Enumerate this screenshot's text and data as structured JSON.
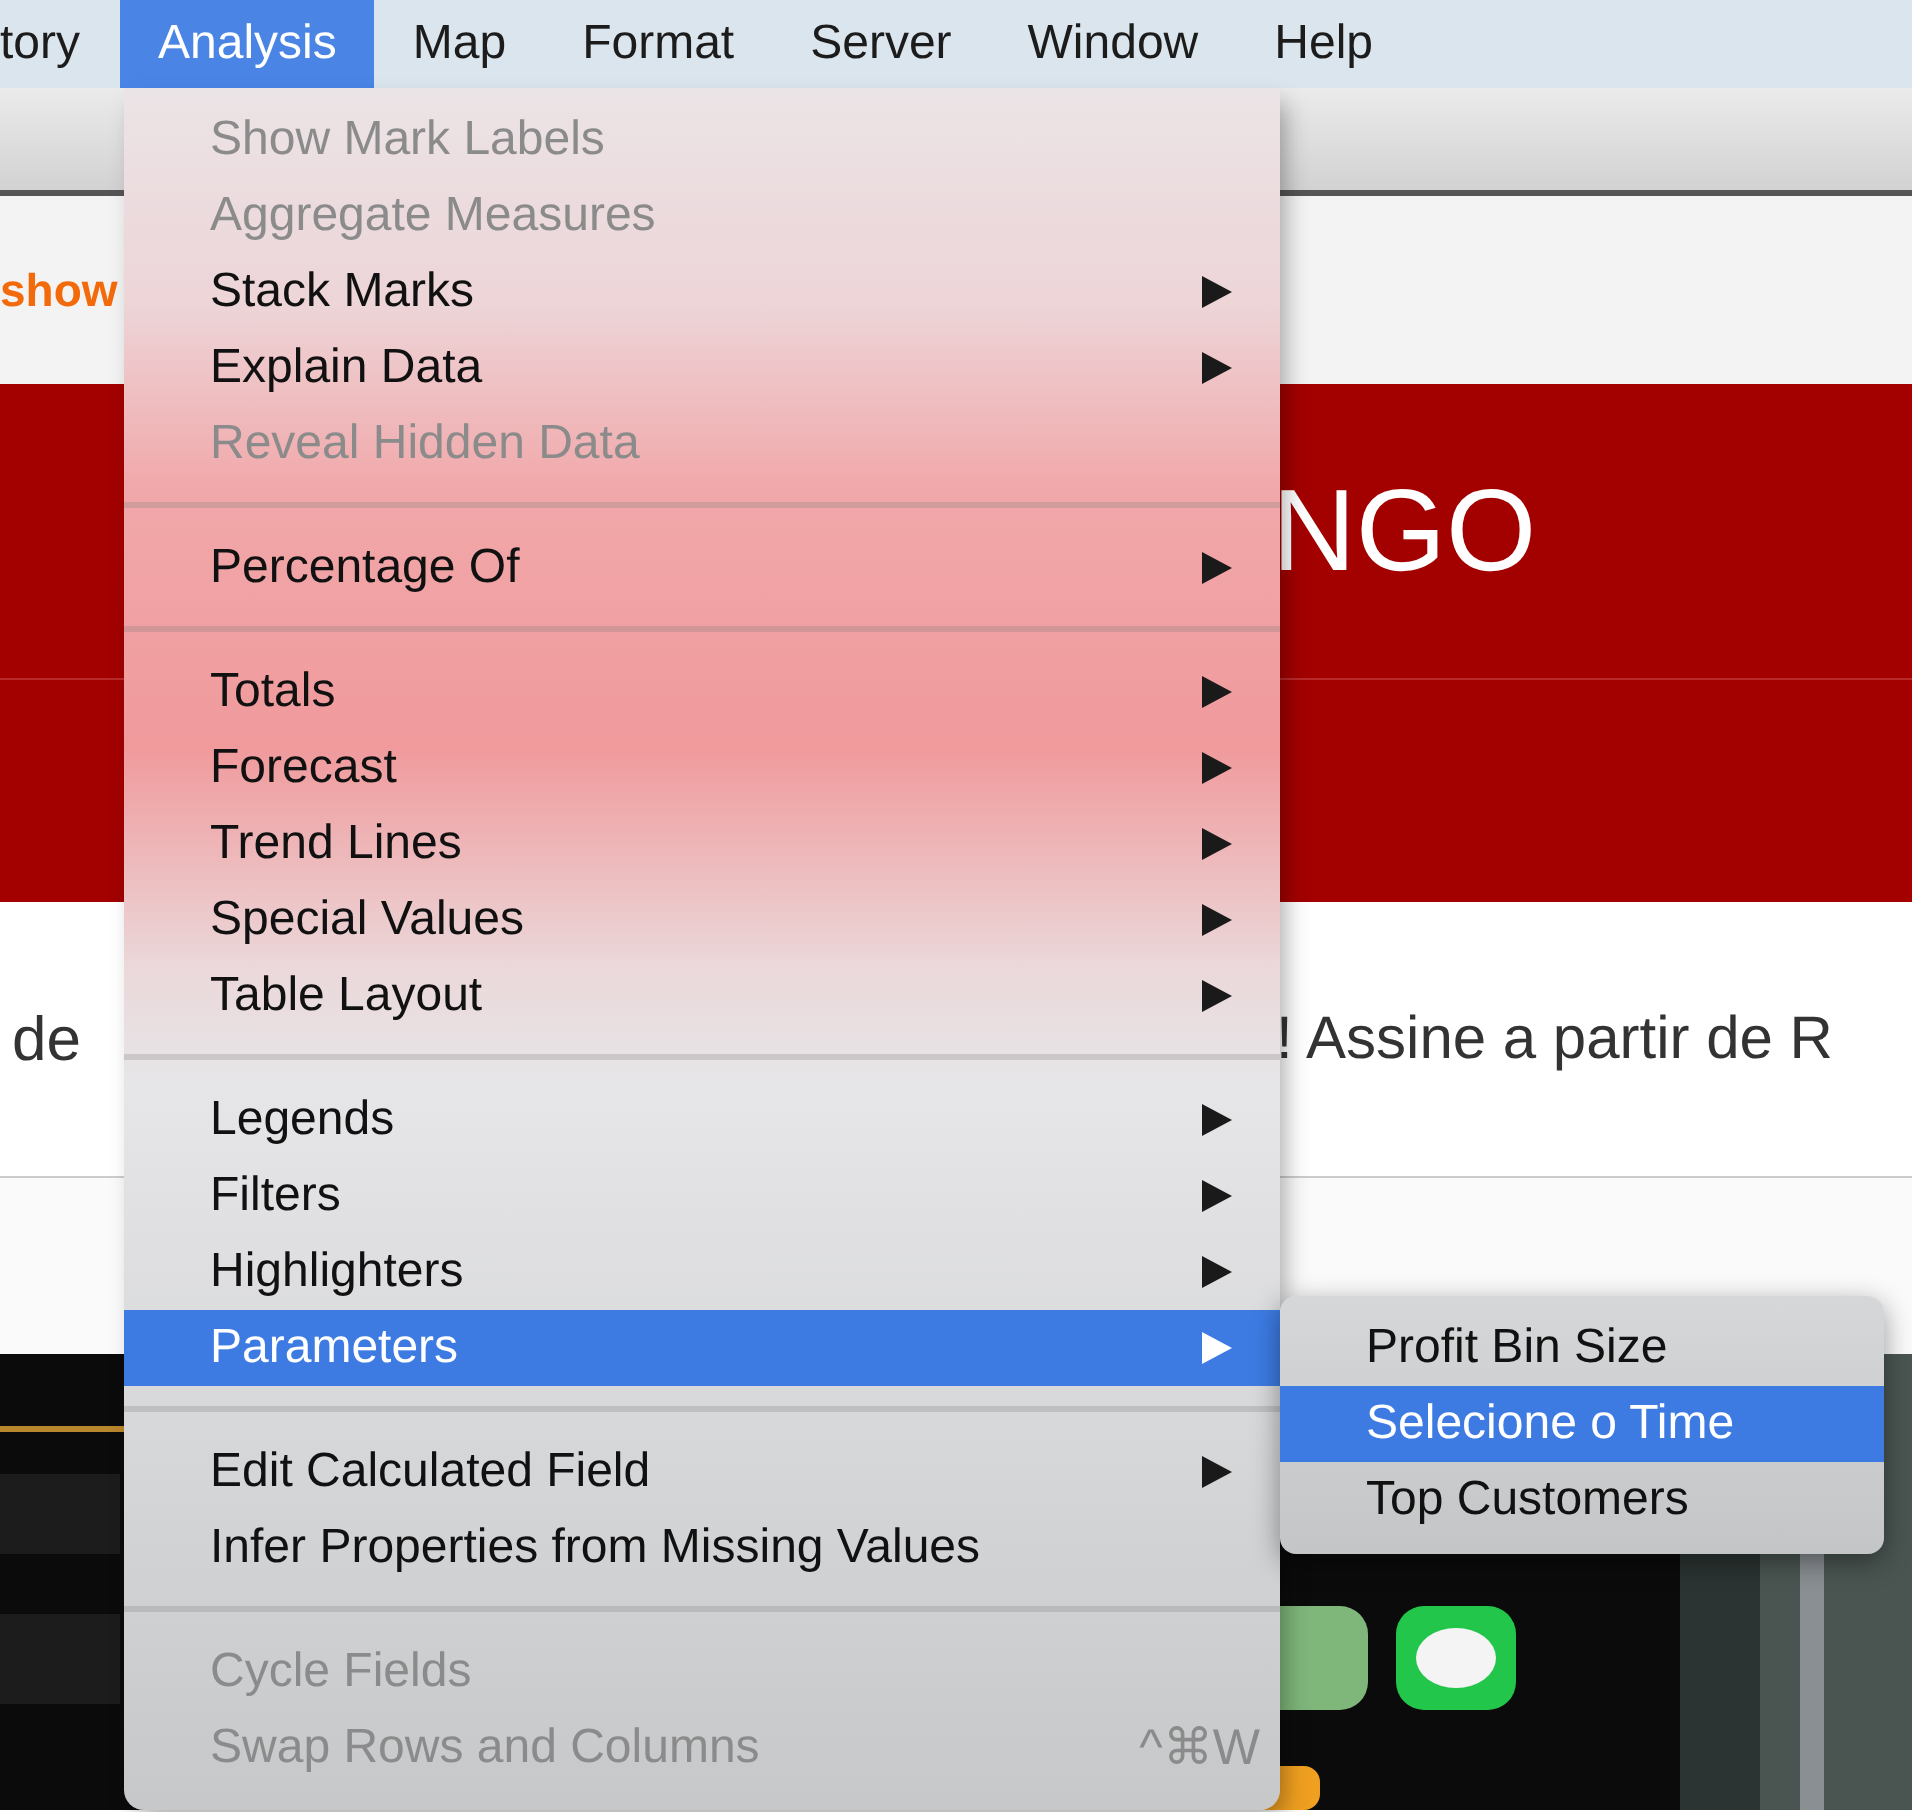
{
  "menu_bar": {
    "items": [
      {
        "label": "tory",
        "selected": false
      },
      {
        "label": "Analysis",
        "selected": true
      },
      {
        "label": "Map",
        "selected": false
      },
      {
        "label": "Format",
        "selected": false
      },
      {
        "label": "Server",
        "selected": false
      },
      {
        "label": "Window",
        "selected": false
      },
      {
        "label": "Help",
        "selected": false
      }
    ]
  },
  "page": {
    "top_link": "show",
    "banner_title": "NGO",
    "promo_text_left": "de",
    "promo_text_right": "! Assine a partir de R"
  },
  "menu": {
    "sections": [
      {
        "items": [
          {
            "label": "Show Mark Labels",
            "disabled": true,
            "submenu": false,
            "selected": false
          },
          {
            "label": "Aggregate Measures",
            "disabled": true,
            "submenu": false,
            "selected": false
          },
          {
            "label": "Stack Marks",
            "disabled": false,
            "submenu": true,
            "selected": false
          },
          {
            "label": "Explain Data",
            "disabled": false,
            "submenu": true,
            "selected": false
          },
          {
            "label": "Reveal Hidden Data",
            "disabled": true,
            "submenu": false,
            "selected": false
          }
        ]
      },
      {
        "items": [
          {
            "label": "Percentage Of",
            "disabled": false,
            "submenu": true,
            "selected": false
          }
        ]
      },
      {
        "items": [
          {
            "label": "Totals",
            "disabled": false,
            "submenu": true,
            "selected": false
          },
          {
            "label": "Forecast",
            "disabled": false,
            "submenu": true,
            "selected": false
          },
          {
            "label": "Trend Lines",
            "disabled": false,
            "submenu": true,
            "selected": false
          },
          {
            "label": "Special Values",
            "disabled": false,
            "submenu": true,
            "selected": false
          },
          {
            "label": "Table Layout",
            "disabled": false,
            "submenu": true,
            "selected": false
          }
        ]
      },
      {
        "items": [
          {
            "label": "Legends",
            "disabled": false,
            "submenu": true,
            "selected": false
          },
          {
            "label": "Filters",
            "disabled": false,
            "submenu": true,
            "selected": false
          },
          {
            "label": "Highlighters",
            "disabled": false,
            "submenu": true,
            "selected": false
          },
          {
            "label": "Parameters",
            "disabled": false,
            "submenu": true,
            "selected": true
          }
        ]
      },
      {
        "items": [
          {
            "label": "Edit Calculated Field",
            "disabled": false,
            "submenu": true,
            "selected": false
          },
          {
            "label": "Infer Properties from Missing Values",
            "disabled": false,
            "submenu": false,
            "selected": false
          }
        ]
      },
      {
        "items": [
          {
            "label": "Cycle Fields",
            "disabled": true,
            "submenu": false,
            "selected": false
          },
          {
            "label": "Swap Rows and Columns",
            "disabled": true,
            "submenu": false,
            "selected": false,
            "shortcut": "^⌘W"
          }
        ]
      }
    ]
  },
  "submenu": {
    "items": [
      {
        "label": "Profit Bin Size",
        "selected": false
      },
      {
        "label": "Selecione o Time",
        "selected": true
      },
      {
        "label": "Top Customers",
        "selected": false
      }
    ]
  }
}
